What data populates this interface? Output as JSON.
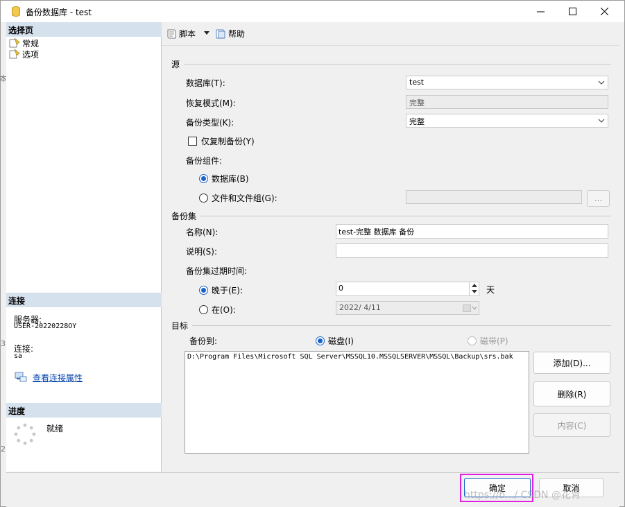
{
  "window": {
    "title": "备份数据库 - test",
    "controls": [
      "minimize",
      "maximize",
      "close"
    ]
  },
  "left": {
    "select_page_header": "选择页",
    "pages": [
      {
        "label": "常规",
        "icon": "page-icon"
      },
      {
        "label": "选项",
        "icon": "page-icon"
      }
    ],
    "connection_header": "连接",
    "server_label": "服务器:",
    "server_value": "USER-20220228OY",
    "connection_label": "连接:",
    "connection_value": "sa",
    "view_props_link": "查看连接属性",
    "progress_header": "进度",
    "progress_status": "就绪"
  },
  "toolbar": {
    "script_label": "脚本",
    "help_label": "帮助"
  },
  "source": {
    "group_label": "源",
    "database_label": "数据库(T):",
    "database_value": "test",
    "recovery_label": "恢复模式(M):",
    "recovery_value": "完整",
    "backup_type_label": "备份类型(K):",
    "backup_type_value": "完整",
    "copy_only_label": "仅复制备份(Y)",
    "component_label": "备份组件:",
    "component_db_label": "数据库(B)",
    "component_files_label": "文件和文件组(G):",
    "browse_label": "..."
  },
  "backup_set": {
    "group_label": "备份集",
    "name_label": "名称(N):",
    "name_value": "test-完整 数据库 备份",
    "desc_label": "说明(S):",
    "desc_value": "",
    "expire_label": "备份集过期时间:",
    "after_label": "晚于(E):",
    "after_value": "0",
    "after_unit": "天",
    "on_label": "在(O):",
    "on_value": "2022/ 4/11"
  },
  "destination": {
    "group_label": "目标",
    "backup_to_label": "备份到:",
    "disk_label": "磁盘(I)",
    "tape_label": "磁带(P)",
    "paths": [
      "D:\\Program Files\\Microsoft SQL Server\\MSSQL10.MSSQLSERVER\\MSSQL\\Backup\\srs.bak"
    ],
    "add_button": "添加(D)...",
    "remove_button": "删除(R)",
    "contents_button": "内容(C)"
  },
  "footer": {
    "ok_button": "确定",
    "cancel_button": "取消"
  },
  "watermark": "https://b.../ CSDN @花青",
  "colors": {
    "section_header_bg": "#d6e1ee",
    "radio_selected": "#1a63c9",
    "link": "#0645ad",
    "highlight_outline": "#e020e0"
  }
}
